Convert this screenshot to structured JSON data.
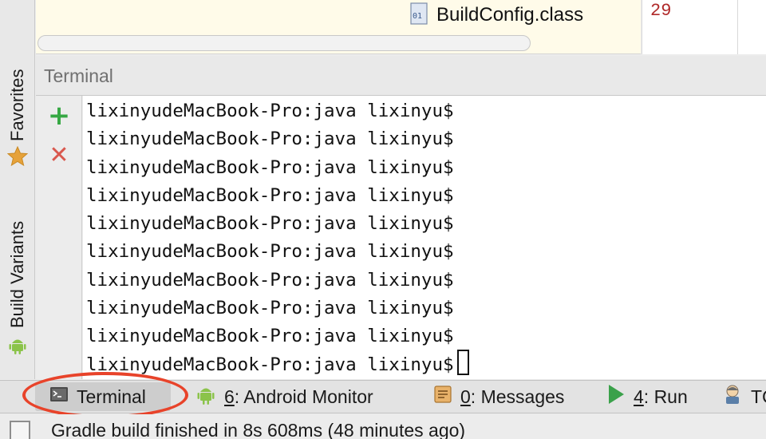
{
  "left_strip": {
    "favorites_label": "Favorites",
    "favorites_icon": "star-icon",
    "build_variants_label": "Build Variants",
    "build_variants_icon": "android-icon"
  },
  "editor": {
    "file_name": "BuildConfig.class",
    "file_icon": "class-file-icon",
    "line_number": "29"
  },
  "terminal": {
    "title": "Terminal",
    "add_icon": "plus-icon",
    "close_icon": "close-icon",
    "lines": [
      "lixinyudeMacBook-Pro:java lixinyu$",
      "lixinyudeMacBook-Pro:java lixinyu$",
      "lixinyudeMacBook-Pro:java lixinyu$",
      "lixinyudeMacBook-Pro:java lixinyu$",
      "lixinyudeMacBook-Pro:java lixinyu$",
      "lixinyudeMacBook-Pro:java lixinyu$",
      "lixinyudeMacBook-Pro:java lixinyu$",
      "lixinyudeMacBook-Pro:java lixinyu$",
      "lixinyudeMacBook-Pro:java lixinyu$",
      "lixinyudeMacBook-Pro:java lixinyu$"
    ]
  },
  "tool_tabs": {
    "terminal": {
      "label": "Terminal",
      "icon": "terminal-icon"
    },
    "android_monitor": {
      "mnemonic": "6",
      "label": ": Android Monitor",
      "icon": "android-icon"
    },
    "messages": {
      "mnemonic": "0",
      "label": ": Messages",
      "icon": "messages-icon"
    },
    "run": {
      "mnemonic": "4",
      "label": ": Run",
      "icon": "run-icon"
    },
    "todo": {
      "label": "TC",
      "icon": "todo-icon"
    }
  },
  "status": {
    "text": "Gradle build finished in 8s 608ms (48 minutes ago)"
  },
  "colors": {
    "highlight_oval": "#e8432a",
    "add_green": "#36a844",
    "close_red": "#d9584e",
    "android_green": "#8bc34a",
    "run_green": "#3aa14a"
  }
}
